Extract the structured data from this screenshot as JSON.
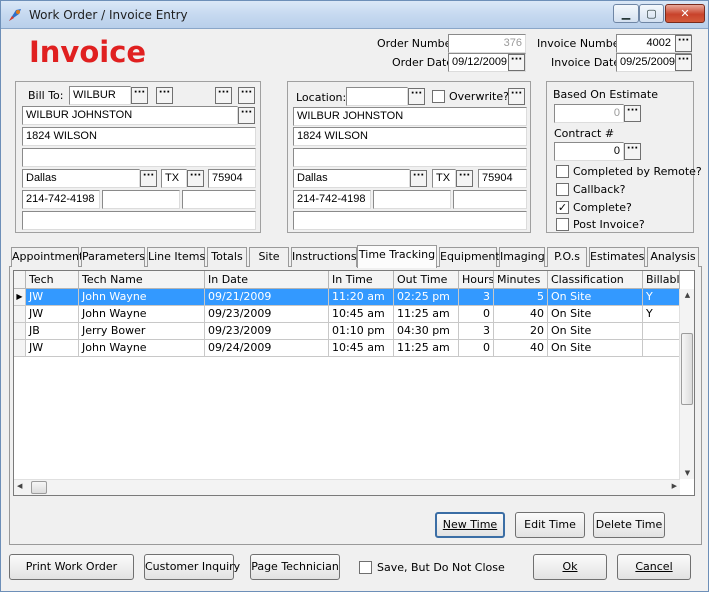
{
  "window": {
    "title": "Work Order /  Invoice Entry",
    "minimize": "▁",
    "maximize": "▢",
    "close": "✕"
  },
  "header": {
    "heading": "Invoice",
    "heading_color": "#e02020",
    "order_number_label": "Order Number",
    "order_number": "376",
    "order_date_label": "Order Date",
    "order_date": "09/12/2009",
    "invoice_number_label": "Invoice Number",
    "invoice_number": "4002",
    "invoice_date_label": "Invoice Date",
    "invoice_date": "09/25/2009"
  },
  "bill_to": {
    "label": "Bill To:",
    "code": "WILBUR",
    "name": "WILBUR JOHNSTON",
    "address1": "1824 WILSON",
    "address2": "",
    "city": "Dallas",
    "state": "TX",
    "zip": "75904",
    "phone": "214-742-4198",
    "phone2": "",
    "phone3": "",
    "extra": ""
  },
  "location": {
    "label": "Location:",
    "code": "",
    "overwrite_label": "Overwrite?",
    "name": "WILBUR JOHNSTON",
    "address1": "1824 WILSON",
    "address2": "",
    "city": "Dallas",
    "state": "TX",
    "zip": "75904",
    "phone": "214-742-4198",
    "phone2": "",
    "phone3": "",
    "extra": ""
  },
  "options": {
    "based_on_estimate_label": "Based On Estimate",
    "based_on_estimate": "0",
    "contract_label": "Contract #",
    "contract": "0",
    "completed_by_remote_label": "Completed by Remote?",
    "callback_label": "Callback?",
    "complete_label": "Complete?",
    "complete_checked": "✓",
    "post_invoice_label": "Post Invoice?"
  },
  "tabs": [
    "Appointment",
    "Parameters",
    "Line Items",
    "Totals",
    "Site",
    "Instructions",
    "Time Tracking",
    "Equipment",
    "Imaging",
    "P.O.s",
    "Estimates",
    "Analysis"
  ],
  "grid": {
    "columns": [
      "Tech",
      "Tech Name",
      "In Date",
      "In Time",
      "Out Time",
      "Hours",
      "Minutes",
      "Classification",
      "Billable"
    ],
    "rows": [
      [
        "JW",
        "John Wayne",
        "09/21/2009",
        "11:20 am",
        "02:25 pm",
        "3",
        "5",
        "On Site",
        "Y"
      ],
      [
        "JW",
        "John Wayne",
        "09/23/2009",
        "10:45 am",
        "11:25 am",
        "0",
        "40",
        "On Site",
        "Y"
      ],
      [
        "JB",
        "Jerry Bower",
        "09/23/2009",
        "01:10 pm",
        "04:30 pm",
        "3",
        "20",
        "On Site",
        ""
      ],
      [
        "JW",
        "John Wayne",
        "09/24/2009",
        "10:45 am",
        "11:25 am",
        "0",
        "40",
        "On Site",
        ""
      ]
    ],
    "selected_row": 0,
    "row_pointer": "▶",
    "scroll_up": "▲",
    "scroll_down": "▼",
    "scroll_left": "◀",
    "scroll_right": "▶"
  },
  "grid_buttons": {
    "new_time": "New Time",
    "edit_time": "Edit Time",
    "delete_time": "Delete Time"
  },
  "footer": {
    "print_work_order": "Print Work Order",
    "customer_inquiry": "Customer Inquiry",
    "page_technician": "Page Technician",
    "save_no_close": "Save, But Do Not Close",
    "ok": "Ok",
    "cancel": "Cancel"
  },
  "dots": "···"
}
